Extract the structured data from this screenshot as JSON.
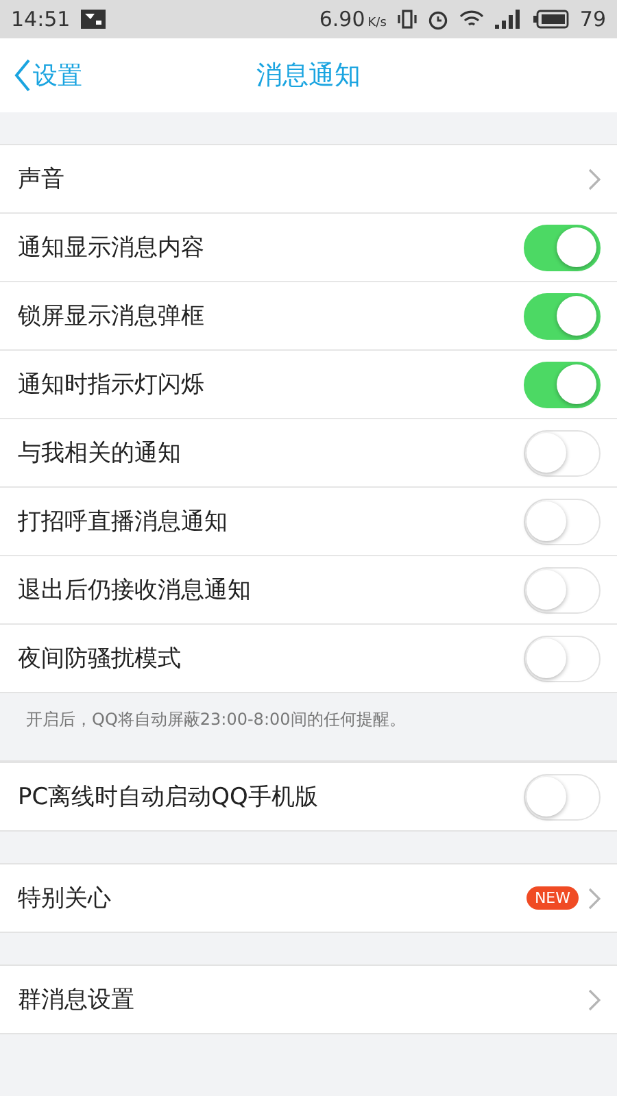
{
  "status_bar": {
    "time": "14:51",
    "speed": "6.90",
    "speed_unit": "K/s",
    "battery": "79"
  },
  "header": {
    "back_label": "设置",
    "title": "消息通知"
  },
  "groups": [
    {
      "rows": [
        {
          "kind": "link",
          "label": "声音"
        },
        {
          "kind": "toggle",
          "label": "通知显示消息内容",
          "on": true
        },
        {
          "kind": "toggle",
          "label": "锁屏显示消息弹框",
          "on": true
        },
        {
          "kind": "toggle",
          "label": "通知时指示灯闪烁",
          "on": true
        },
        {
          "kind": "toggle",
          "label": "与我相关的通知",
          "on": false
        },
        {
          "kind": "toggle",
          "label": "打招呼直播消息通知",
          "on": false
        },
        {
          "kind": "toggle",
          "label": "退出后仍接收消息通知",
          "on": false
        },
        {
          "kind": "toggle",
          "label": "夜间防骚扰模式",
          "on": false
        }
      ],
      "note": "开启后，QQ将自动屏蔽23:00-8:00间的任何提醒。"
    },
    {
      "rows": [
        {
          "kind": "toggle",
          "label": "PC离线时自动启动QQ手机版",
          "on": false
        }
      ]
    },
    {
      "rows": [
        {
          "kind": "link",
          "label": "特别关心",
          "badge": "NEW"
        }
      ]
    },
    {
      "rows": [
        {
          "kind": "link",
          "label": "群消息设置"
        }
      ]
    }
  ]
}
